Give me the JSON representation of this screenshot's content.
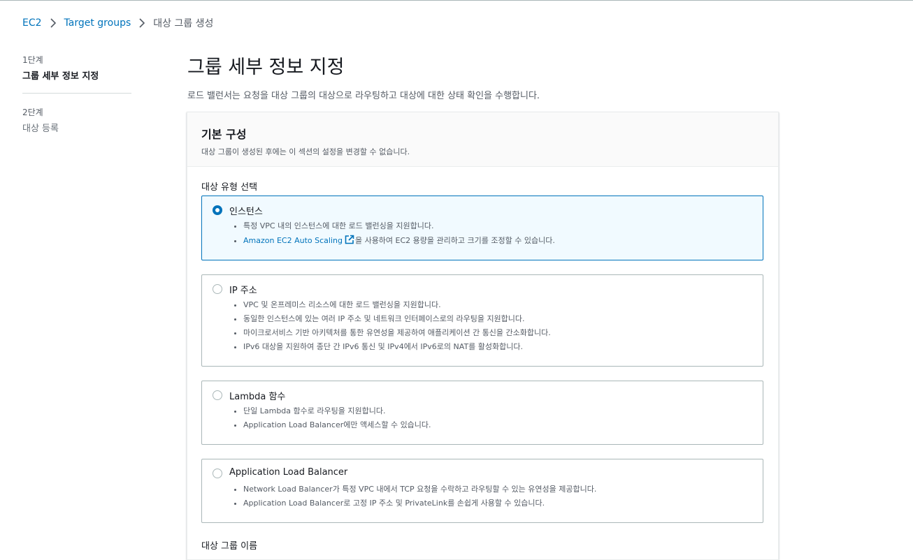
{
  "breadcrumb": {
    "ec2": "EC2",
    "target_groups": "Target groups",
    "current": "대상 그룹 생성"
  },
  "steps": [
    {
      "number": "1단계",
      "title": "그룹 세부 정보 지정"
    },
    {
      "number": "2단계",
      "title": "대상 등록"
    }
  ],
  "page": {
    "title": "그룹 세부 정보 지정",
    "description": "로드 밸런서는 요청을 대상 그룹의 대상으로 라우팅하고 대상에 대한 상태 확인을 수행합니다."
  },
  "basic_config": {
    "title": "기본 구성",
    "subtitle": "대상 그룹이 생성된 후에는 이 섹션의 설정을 변경할 수 없습니다.",
    "target_type_label": "대상 유형 선택",
    "options": [
      {
        "title": "인스턴스",
        "selected": true,
        "bullets": [
          "특정 VPC 내의 인스턴스에 대한 로드 밸런싱을 지원합니다."
        ],
        "link_bullet": {
          "link": "Amazon EC2 Auto Scaling",
          "rest": "을 사용하여 EC2 용량을 관리하고 크기를 조정할 수 있습니다."
        }
      },
      {
        "title": "IP 주소",
        "selected": false,
        "bullets": [
          "VPC 및 온프레미스 리소스에 대한 로드 밸런싱을 지원합니다.",
          "동일한 인스턴스에 있는 여러 IP 주소 및 네트워크 인터페이스로의 라우팅을 지원합니다.",
          "마이크로서비스 기반 아키텍처를 통한 유연성을 제공하여 애플리케이션 간 통신을 간소화합니다.",
          "IPv6 대상을 지원하여 종단 간 IPv6 통신 및 IPv4에서 IPv6로의 NAT를 활성화합니다."
        ]
      },
      {
        "title": "Lambda 함수",
        "selected": false,
        "bullets": [
          "단일 Lambda 함수로 라우팅을 지원합니다.",
          "Application Load Balancer에만 액세스할 수 있습니다."
        ]
      },
      {
        "title": "Application Load Balancer",
        "selected": false,
        "bullets": [
          "Network Load Balancer가 특정 VPC 내에서 TCP 요청을 수락하고 라우팅할 수 있는 유연성을 제공합니다.",
          "Application Load Balancer로 고정 IP 주소 및 PrivateLink를 손쉽게 사용할 수 있습니다."
        ]
      }
    ],
    "target_group_name_label": "대상 그룹 이름"
  },
  "icons": {
    "separator": "chevron-right-icon",
    "external": "external-link-icon",
    "radio": "radio-icon"
  },
  "colors": {
    "link": "#0073bb",
    "selected_bg": "#f1faff",
    "selected_border": "#0073bb",
    "text": "#16191f",
    "muted": "#545b64"
  }
}
